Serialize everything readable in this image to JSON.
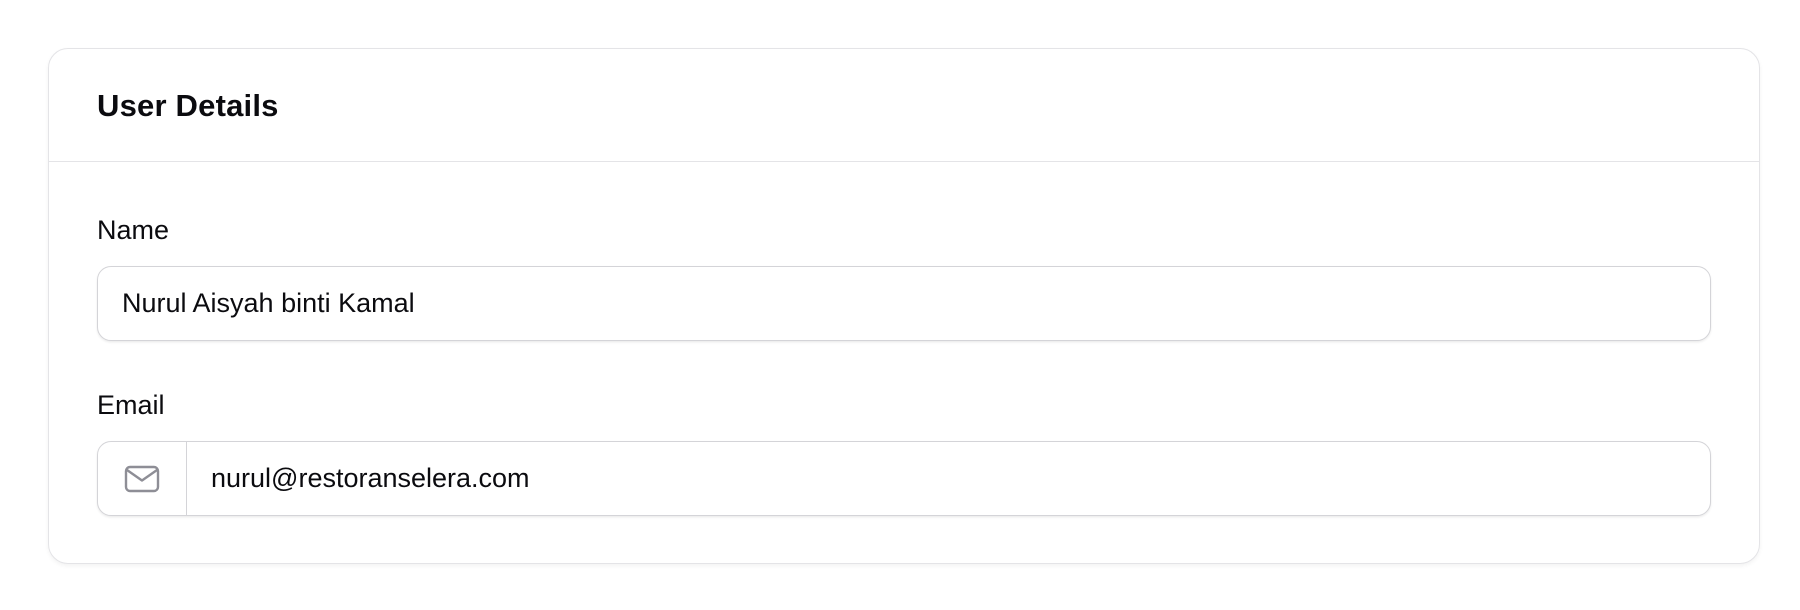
{
  "card": {
    "title": "User Details"
  },
  "form": {
    "name": {
      "label": "Name",
      "value": "Nurul Aisyah binti Kamal"
    },
    "email": {
      "label": "Email",
      "value": "nurul@restoranselera.com",
      "icon": "mail-icon"
    }
  },
  "colors": {
    "border": "#e4e4e7",
    "input_border": "#d4d4d8",
    "text": "#0b0b0f",
    "icon": "#8e8e96"
  }
}
